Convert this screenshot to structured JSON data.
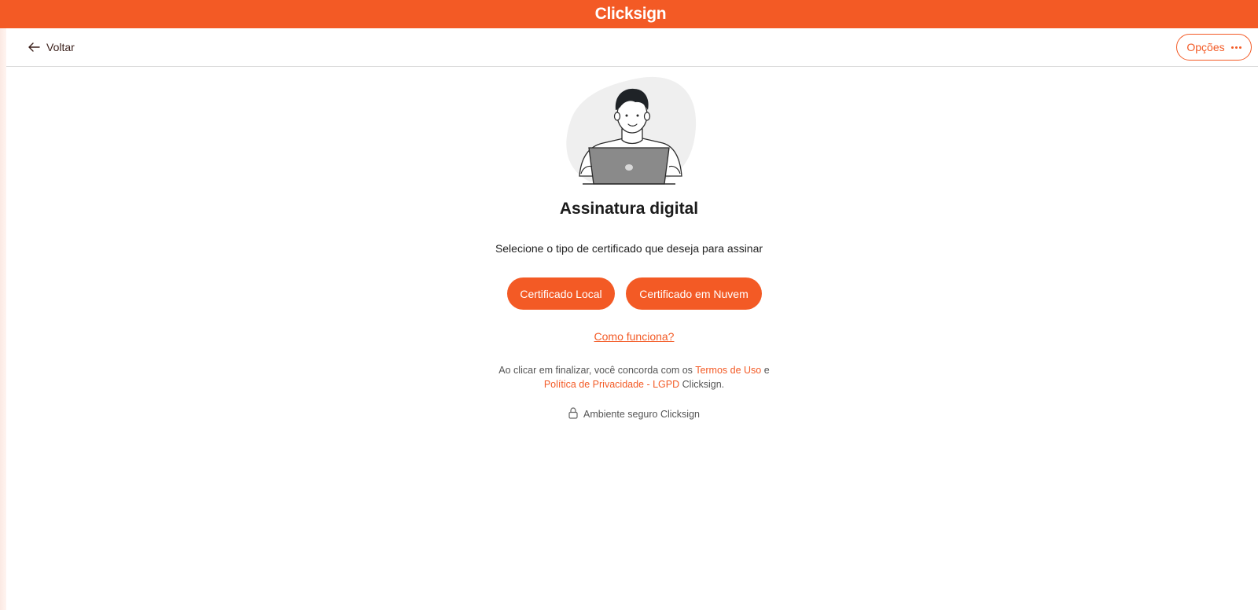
{
  "brand": {
    "name": "Clicksign",
    "color": "#f35a25"
  },
  "nav": {
    "back_label": "Voltar",
    "back_icon": "arrow-left-icon",
    "options_label": "Opções",
    "options_icon": "more-horizontal-icon"
  },
  "main": {
    "illustration": "person-with-laptop-illustration",
    "title": "Assinatura digital",
    "subtitle": "Selecione o tipo de certificado que deseja para assinar",
    "buttons": {
      "local": "Certificado Local",
      "cloud": "Certificado em Nuvem"
    },
    "how_link": "Como funciona?",
    "legal": {
      "prefix": "Ao clicar em finalizar, você concorda com os",
      "terms_link": "Termos de Uso",
      "connector": "e",
      "privacy_link": "Política de Privacidade - LGPD",
      "suffix": "Clicksign."
    },
    "secure": {
      "icon": "lock-icon",
      "text": "Ambiente seguro Clicksign"
    }
  }
}
